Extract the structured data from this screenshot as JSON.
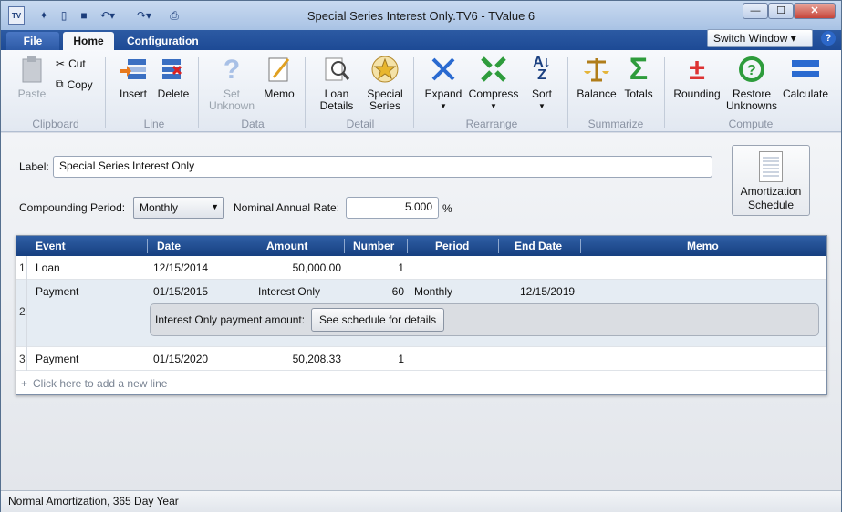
{
  "window": {
    "title": "Special Series Interest Only.TV6 - TValue 6",
    "min": "—",
    "max": "☐",
    "close": "✕"
  },
  "quick_access": {
    "app_icon": "TV",
    "icons": [
      "new-icon",
      "open-icon",
      "save-icon",
      "undo-icon",
      "redo-icon",
      "print-icon"
    ]
  },
  "tabs": [
    {
      "label": "File"
    },
    {
      "label": "Home"
    },
    {
      "label": "Configuration"
    }
  ],
  "switch_window": {
    "label": "Switch Window"
  },
  "help": {
    "label": "?"
  },
  "ribbon": {
    "clipboard": {
      "paste": "Paste",
      "cut": "Cut",
      "copy": "Copy",
      "group": "Clipboard"
    },
    "line": {
      "insert": "Insert",
      "delete": "Delete",
      "group": "Line"
    },
    "data": {
      "set_unknown_1": "Set",
      "set_unknown_2": "Unknown",
      "memo": "Memo",
      "group": "Data"
    },
    "detail": {
      "loan_details_1": "Loan",
      "loan_details_2": "Details",
      "special_series_1": "Special",
      "special_series_2": "Series",
      "group": "Detail"
    },
    "rearrange": {
      "expand": "Expand",
      "compress": "Compress",
      "sort": "Sort",
      "group": "Rearrange"
    },
    "summarize": {
      "balance": "Balance",
      "totals": "Totals",
      "group": "Summarize"
    },
    "compute": {
      "rounding": "Rounding",
      "restore_1": "Restore",
      "restore_2": "Unknowns",
      "calculate": "Calculate",
      "group": "Compute"
    }
  },
  "form": {
    "label_caption": "Label:",
    "label_value": "Special Series Interest Only",
    "compounding_caption": "Compounding Period:",
    "compounding_value": "Monthly",
    "rate_caption": "Nominal Annual Rate:",
    "rate_value": "5.000",
    "rate_unit": "%"
  },
  "amortization": {
    "line1": "Amortization",
    "line2": "Schedule"
  },
  "grid": {
    "columns": [
      "Event",
      "Date",
      "Amount",
      "Number",
      "Period",
      "End Date",
      "Memo"
    ],
    "rows": [
      {
        "num": "1",
        "event": "Loan",
        "date": "12/15/2014",
        "amount": "50,000.00",
        "number": "1",
        "period": "",
        "end": ""
      },
      {
        "num": "2",
        "event": "Payment",
        "date": "01/15/2015",
        "amount": "Interest Only",
        "number": "60",
        "period": "Monthly",
        "end": "12/15/2019"
      },
      {
        "num": "3",
        "event": "Payment",
        "date": "01/15/2020",
        "amount": "50,208.33",
        "number": "1",
        "period": "",
        "end": ""
      }
    ],
    "sub_label": "Interest Only payment amount:",
    "sub_button": "See schedule for details",
    "add_line": "Click here to add a new line",
    "add_plus": "+"
  },
  "status": {
    "text": "Normal Amortization, 365 Day Year"
  }
}
